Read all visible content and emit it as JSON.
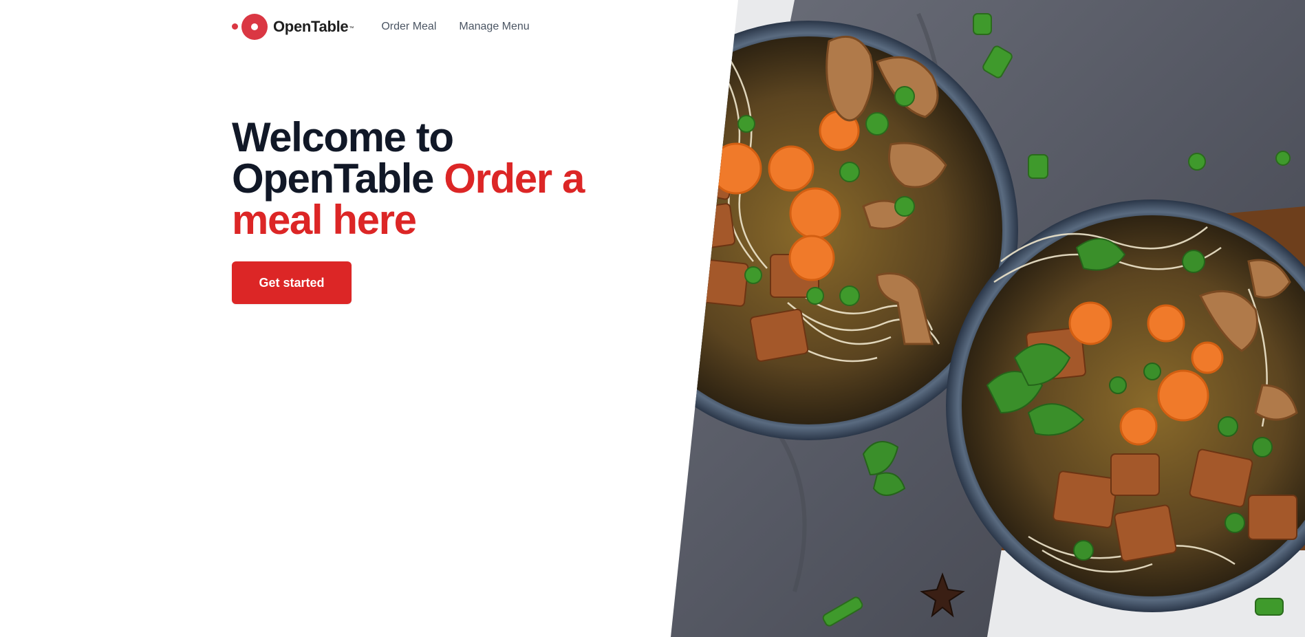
{
  "header": {
    "brand": "OpenTable",
    "brand_tm": "™",
    "nav": [
      {
        "label": "Order Meal"
      },
      {
        "label": "Manage Menu"
      }
    ]
  },
  "hero": {
    "title_line1": "Welcome to",
    "title_line2": "OpenTable",
    "title_accent_line2": "Order a",
    "title_accent_line3": "meal here",
    "cta_label": "Get started",
    "image_subject": "two bowls of noodle soup with tofu, carrots, mushrooms and greens on a grey napkin"
  },
  "colors": {
    "brand_red": "#da3743",
    "accent_red": "#dc2626",
    "heading": "#111827",
    "nav_text": "#4b5563"
  }
}
